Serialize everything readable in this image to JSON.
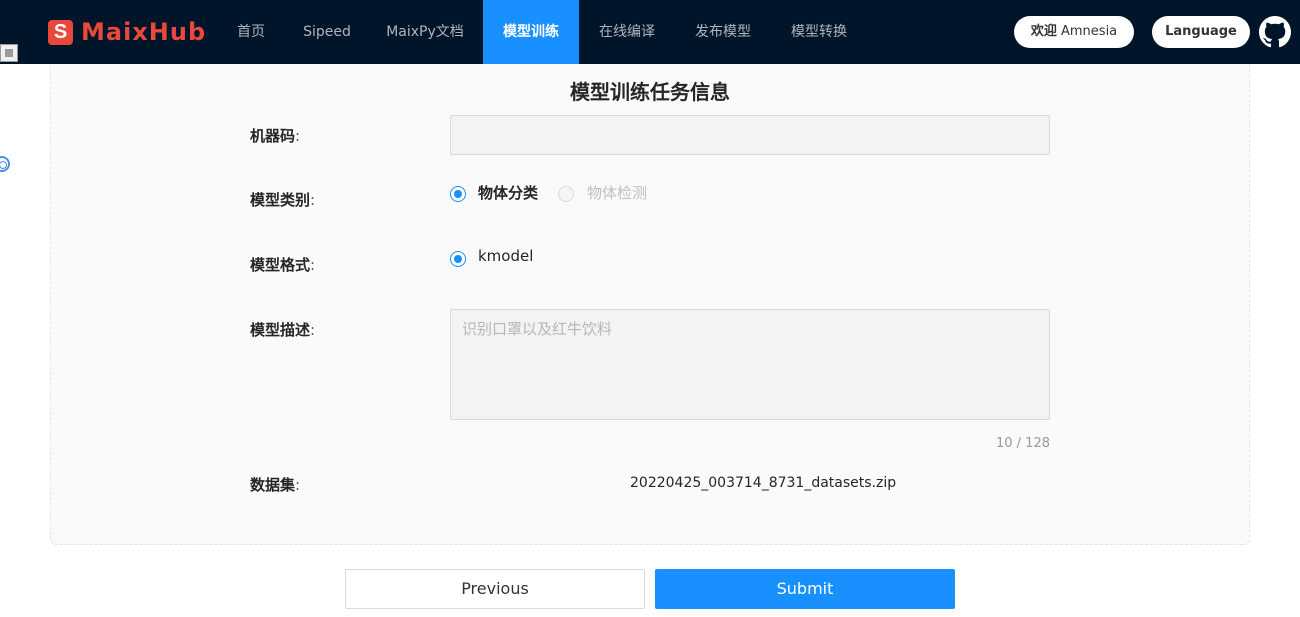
{
  "navbar": {
    "logo_mark": "S",
    "logo_text": "MaixHub",
    "items": [
      {
        "label": "首页"
      },
      {
        "label": "Sipeed"
      },
      {
        "label": "MaixPy文档"
      },
      {
        "label": "模型训练",
        "active": true
      },
      {
        "label": "在线编译"
      },
      {
        "label": "发布模型"
      },
      {
        "label": "模型转换"
      }
    ],
    "welcome_prefix": "欢迎",
    "welcome_name": "Amnesia",
    "language_button": "Language",
    "github_icon": "github-icon"
  },
  "form": {
    "title": "模型训练任务信息",
    "machine_code": {
      "label": "机器码",
      "value": ""
    },
    "model_type": {
      "label": "模型类别",
      "options": [
        {
          "label": "物体分类",
          "checked": true,
          "disabled": false
        },
        {
          "label": "物体检测",
          "checked": false,
          "disabled": true
        }
      ]
    },
    "model_format": {
      "label": "模型格式",
      "options": [
        {
          "label": "kmodel",
          "checked": true
        }
      ]
    },
    "model_desc": {
      "label": "模型描述",
      "placeholder": "识别口罩以及红牛饮料",
      "counter": "10 / 128"
    },
    "dataset": {
      "label": "数据集",
      "file": "20220425_003714_8731_datasets.zip"
    },
    "colon": ":"
  },
  "buttons": {
    "previous": "Previous",
    "submit": "Submit"
  },
  "colors": {
    "nav_bg": "#001529",
    "accent": "#1890ff",
    "brand": "#e8493b"
  }
}
